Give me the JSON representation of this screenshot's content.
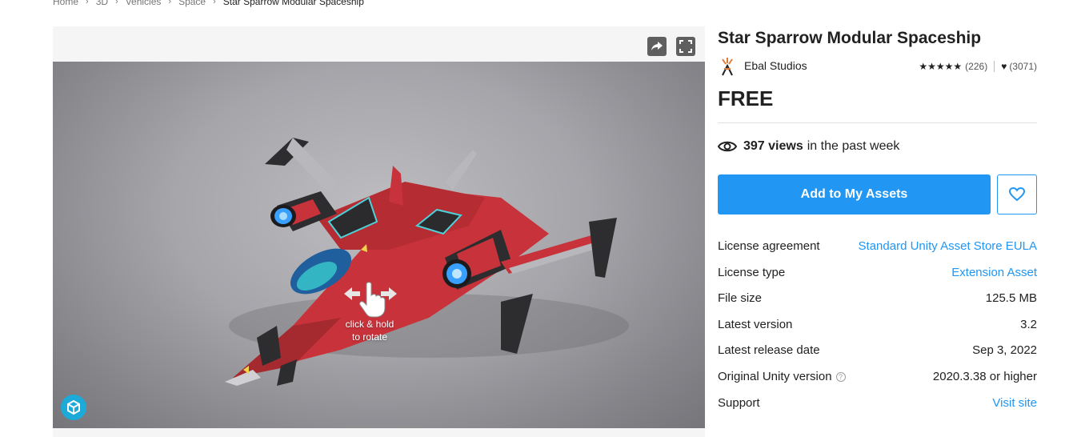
{
  "breadcrumb": {
    "items": [
      "Home",
      "3D",
      "Vehicles",
      "Space",
      "Star Sparrow Modular Spaceship"
    ]
  },
  "viewer": {
    "share_icon": "share-arrow-icon",
    "fullscreen_icon": "fullscreen-icon",
    "rotate_hint": "click & hold\nto rotate",
    "viewer_logo_icon": "sketchfab-logo-icon"
  },
  "product": {
    "title": "Star Sparrow Modular Spaceship",
    "publisher": "Ebal Studios",
    "rating_count": "(226)",
    "favorites_count": "(3071)",
    "price": "FREE",
    "views_count": "397 views",
    "views_suffix": "in the past week",
    "add_button": "Add to My Assets"
  },
  "details": [
    {
      "label": "License agreement",
      "value": "Standard Unity Asset Store EULA",
      "link": true
    },
    {
      "label": "License type",
      "value": "Extension Asset",
      "link": true
    },
    {
      "label": "File size",
      "value": "125.5 MB",
      "link": false
    },
    {
      "label": "Latest version",
      "value": "3.2",
      "link": false
    },
    {
      "label": "Latest release date",
      "value": "Sep 3, 2022",
      "link": false
    },
    {
      "label": "Original Unity version",
      "value": "2020.3.38 or higher",
      "link": false,
      "help": true
    },
    {
      "label": "Support",
      "value": "Visit site",
      "link": true
    }
  ],
  "colors": {
    "accent": "#2196f3",
    "ship_red": "#c8323a",
    "ship_dark": "#3a3a3c",
    "engine_glow": "#3aa0ff"
  }
}
